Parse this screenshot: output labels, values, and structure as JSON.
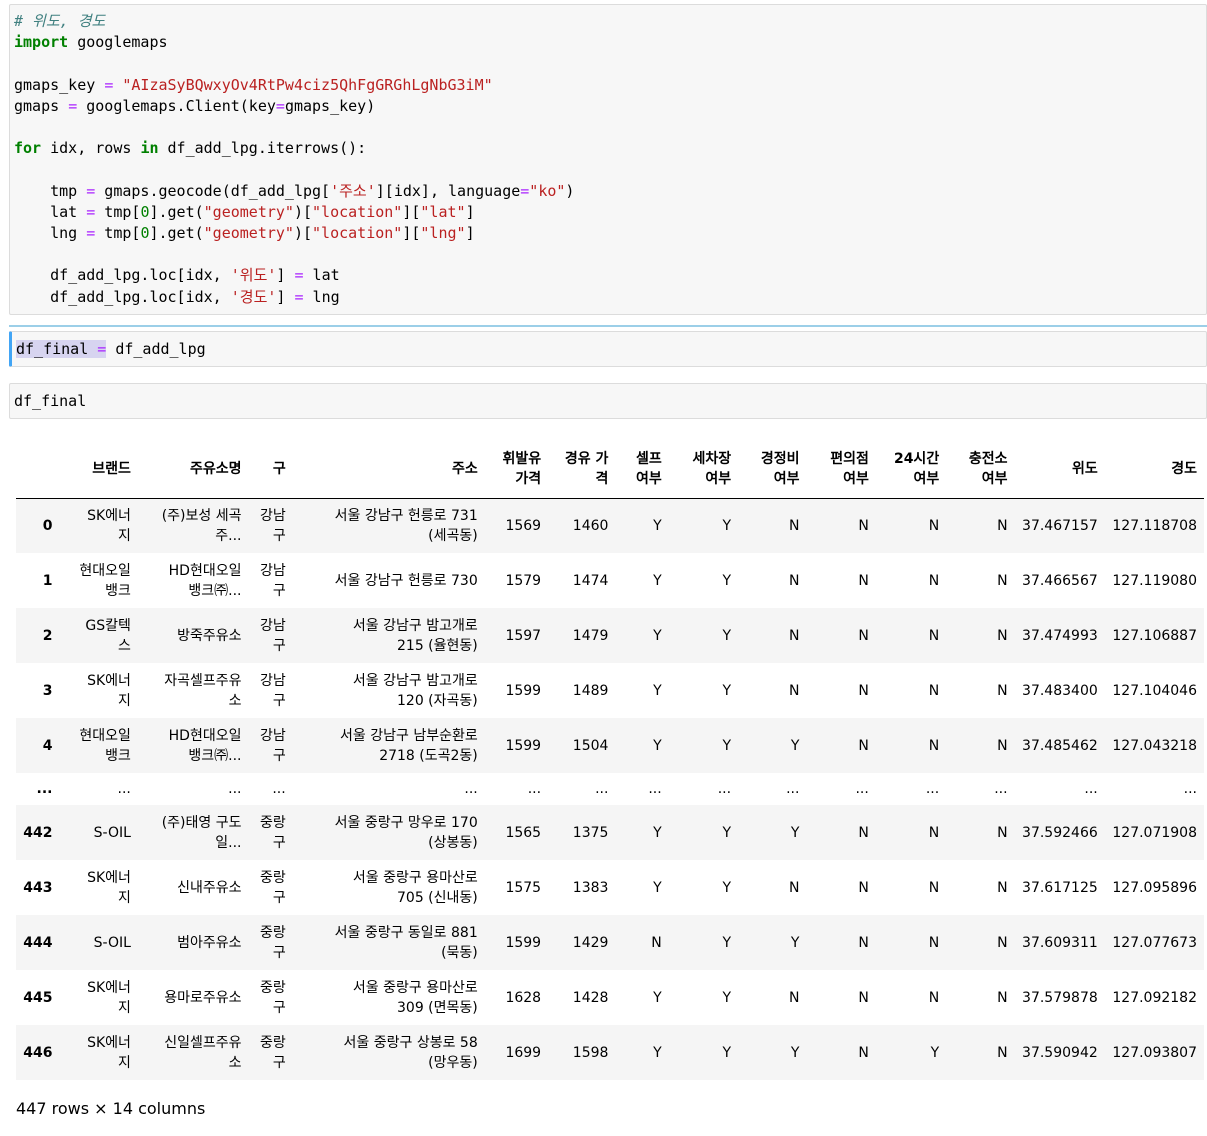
{
  "cells": [
    {
      "lines": [
        [
          {
            "t": "# 위도, 경도",
            "c": "cm"
          }
        ],
        [
          {
            "t": "import",
            "c": "kw"
          },
          {
            "t": " googlemaps"
          }
        ],
        [],
        [
          {
            "t": "gmaps_key "
          },
          {
            "t": "=",
            "c": "op"
          },
          {
            "t": " "
          },
          {
            "t": "\"AIzaSyBQwxyOv4RtPw4ciz5QhFgGRGhLgNbG3iM\"",
            "c": "str"
          }
        ],
        [
          {
            "t": "gmaps "
          },
          {
            "t": "=",
            "c": "op"
          },
          {
            "t": " googlemaps.Client(key"
          },
          {
            "t": "=",
            "c": "op"
          },
          {
            "t": "gmaps_key)"
          }
        ],
        [],
        [
          {
            "t": "for",
            "c": "kw"
          },
          {
            "t": " idx, rows "
          },
          {
            "t": "in",
            "c": "kw"
          },
          {
            "t": " df_add_lpg.iterrows():"
          }
        ],
        [],
        [
          {
            "t": "    tmp "
          },
          {
            "t": "=",
            "c": "op"
          },
          {
            "t": " gmaps.geocode(df_add_lpg["
          },
          {
            "t": "'주소'",
            "c": "str"
          },
          {
            "t": "][idx], language"
          },
          {
            "t": "=",
            "c": "op"
          },
          {
            "t": "\"ko\"",
            "c": "str"
          },
          {
            "t": ")"
          }
        ],
        [
          {
            "t": "    lat "
          },
          {
            "t": "=",
            "c": "op"
          },
          {
            "t": " tmp["
          },
          {
            "t": "0",
            "c": "kw0"
          },
          {
            "t": "].get("
          },
          {
            "t": "\"geometry\"",
            "c": "str"
          },
          {
            "t": ")["
          },
          {
            "t": "\"location\"",
            "c": "str"
          },
          {
            "t": "]["
          },
          {
            "t": "\"lat\"",
            "c": "str"
          },
          {
            "t": "]"
          }
        ],
        [
          {
            "t": "    lng "
          },
          {
            "t": "=",
            "c": "op"
          },
          {
            "t": " tmp["
          },
          {
            "t": "0",
            "c": "kw0"
          },
          {
            "t": "].get("
          },
          {
            "t": "\"geometry\"",
            "c": "str"
          },
          {
            "t": ")["
          },
          {
            "t": "\"location\"",
            "c": "str"
          },
          {
            "t": "]["
          },
          {
            "t": "\"lng\"",
            "c": "str"
          },
          {
            "t": "]"
          }
        ],
        [],
        [
          {
            "t": "    df_add_lpg.loc[idx, "
          },
          {
            "t": "'위도'",
            "c": "str"
          },
          {
            "t": "] "
          },
          {
            "t": "=",
            "c": "op"
          },
          {
            "t": " lat"
          }
        ],
        [
          {
            "t": "    df_add_lpg.loc[idx, "
          },
          {
            "t": "'경도'",
            "c": "str"
          },
          {
            "t": "] "
          },
          {
            "t": "=",
            "c": "op"
          },
          {
            "t": " lng"
          }
        ]
      ]
    },
    {
      "lines": [
        [
          {
            "t": "df_final ",
            "c": "hl"
          },
          {
            "t": "=",
            "c": "op hl"
          },
          {
            "t": " df_add_lpg"
          }
        ]
      ]
    },
    {
      "lines": [
        [
          {
            "t": "df_final"
          }
        ]
      ]
    }
  ],
  "table": {
    "columns": [
      "",
      "브랜드",
      "주유소명",
      "구",
      "주소",
      "휘발유\n가격",
      "경유 가\n격",
      "셀프\n여부",
      "세차장\n여부",
      "경정비\n여부",
      "편의점\n여부",
      "24시간\n여부",
      "충전소\n여부",
      "위도",
      "경도"
    ],
    "rows": [
      [
        "0",
        "SK에너\n지",
        "(주)보성 세곡\n주...",
        "강남\n구",
        "서울 강남구 헌릉로 731\n(세곡동)",
        "1569",
        "1460",
        "Y",
        "Y",
        "N",
        "N",
        "N",
        "N",
        "37.467157",
        "127.118708"
      ],
      [
        "1",
        "현대오일\n뱅크",
        "HD현대오일\n뱅크㈜...",
        "강남\n구",
        "서울 강남구 헌릉로 730",
        "1579",
        "1474",
        "Y",
        "Y",
        "N",
        "N",
        "N",
        "N",
        "37.466567",
        "127.119080"
      ],
      [
        "2",
        "GS칼텍\n스",
        "방죽주유소",
        "강남\n구",
        "서울 강남구 밤고개로\n215 (율현동)",
        "1597",
        "1479",
        "Y",
        "Y",
        "N",
        "N",
        "N",
        "N",
        "37.474993",
        "127.106887"
      ],
      [
        "3",
        "SK에너\n지",
        "자곡셀프주유\n소",
        "강남\n구",
        "서울 강남구 밤고개로\n120 (자곡동)",
        "1599",
        "1489",
        "Y",
        "Y",
        "N",
        "N",
        "N",
        "N",
        "37.483400",
        "127.104046"
      ],
      [
        "4",
        "현대오일\n뱅크",
        "HD현대오일\n뱅크㈜...",
        "강남\n구",
        "서울 강남구 남부순환로\n2718 (도곡2동)",
        "1599",
        "1504",
        "Y",
        "Y",
        "Y",
        "N",
        "N",
        "N",
        "37.485462",
        "127.043218"
      ],
      [
        "...",
        "...",
        "...",
        "...",
        "...",
        "...",
        "...",
        "...",
        "...",
        "...",
        "...",
        "...",
        "...",
        "...",
        "..."
      ],
      [
        "442",
        "S-OIL",
        "(주)태영 구도\n일...",
        "중랑\n구",
        "서울 중랑구 망우로 170\n(상봉동)",
        "1565",
        "1375",
        "Y",
        "Y",
        "Y",
        "N",
        "N",
        "N",
        "37.592466",
        "127.071908"
      ],
      [
        "443",
        "SK에너\n지",
        "신내주유소",
        "중랑\n구",
        "서울 중랑구 용마산로\n705 (신내동)",
        "1575",
        "1383",
        "Y",
        "Y",
        "N",
        "N",
        "N",
        "N",
        "37.617125",
        "127.095896"
      ],
      [
        "444",
        "S-OIL",
        "범아주유소",
        "중랑\n구",
        "서울 중랑구 동일로 881\n(묵동)",
        "1599",
        "1429",
        "N",
        "Y",
        "Y",
        "N",
        "N",
        "N",
        "37.609311",
        "127.077673"
      ],
      [
        "445",
        "SK에너\n지",
        "용마로주유소",
        "중랑\n구",
        "서울 중랑구 용마산로\n309 (면목동)",
        "1628",
        "1428",
        "Y",
        "Y",
        "N",
        "N",
        "N",
        "N",
        "37.579878",
        "127.092182"
      ],
      [
        "446",
        "SK에너\n지",
        "신일셀프주유\n소",
        "중랑\n구",
        "서울 중랑구 상봉로 58\n(망우동)",
        "1699",
        "1598",
        "Y",
        "Y",
        "Y",
        "N",
        "Y",
        "N",
        "37.590942",
        "127.093807"
      ]
    ],
    "shape": "447 rows × 14 columns"
  }
}
